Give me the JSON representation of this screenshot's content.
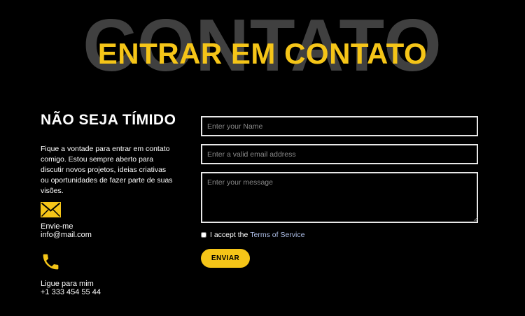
{
  "background_word": "CONTATO",
  "title": "ENTRAR EM CONTATO",
  "left": {
    "heading": "NÃO SEJA TÍMIDO",
    "description": "Fique a vontade para entrar em contato comigo. Estou sempre aberto para discutir novos projetos, ideias criativas ou oportunidades de fazer parte de suas visões.",
    "email": {
      "icon": "envelope-icon",
      "label": "Envie-me",
      "value": "info@mail.com"
    },
    "phone": {
      "icon": "phone-icon",
      "label": "Ligue para mim",
      "value": "+1 333 454 55 44"
    }
  },
  "form": {
    "name_placeholder": "Enter your Name",
    "email_placeholder": "Enter a valid email address",
    "message_placeholder": "Enter your message",
    "terms_prefix": "I accept the",
    "terms_link": "Terms of Service",
    "submit_label": "ENVIAR"
  },
  "colors": {
    "accent": "#f5c518",
    "background": "#000000",
    "background_word": "#404040",
    "link": "#aebfe8"
  }
}
